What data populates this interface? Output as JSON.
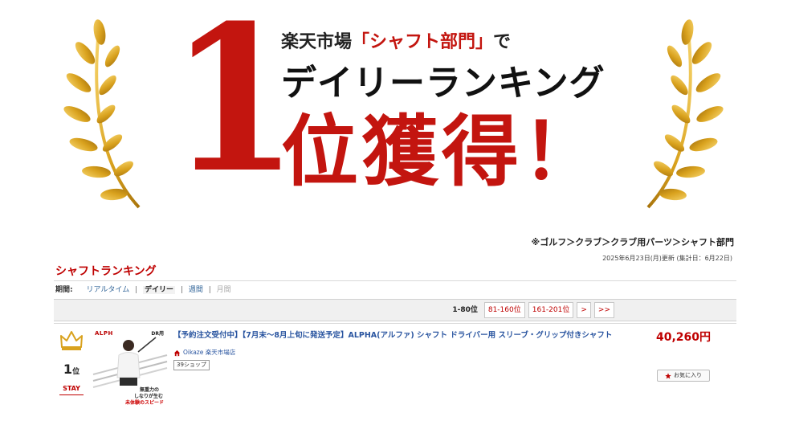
{
  "banner": {
    "line1_pre": "楽天市場",
    "line1_bracket": "「シャフト部門」",
    "line1_post": "で",
    "line2": "デイリーランキング",
    "big_number": "1",
    "line3": "位獲得！"
  },
  "breadcrumb": "※ゴルフ＞クラブ＞クラブ用パーツ＞シャフト部門",
  "updated": "2025年6月23日(月)更新 (集計日：6月22日)",
  "ranking_title": "シャフトランキング",
  "period": {
    "label": "期間:",
    "options": [
      "リアルタイム",
      "デイリー",
      "週間",
      "月間"
    ],
    "active": "デイリー"
  },
  "pager": {
    "current": "1-80位",
    "pages": [
      "81-160位",
      "161-201位",
      ">",
      ">>"
    ]
  },
  "item": {
    "rank": "1",
    "rank_suffix": "位",
    "status": "STAY",
    "thumb": {
      "logo": "ALPH",
      "dr": "DR用",
      "text1": "無重力の",
      "text2": "しなりが生む",
      "text3": "未体験のスピード"
    },
    "title": "【予約注文受付中】【7月末～8月上旬に発送予定】ALPHA(アルファ) シャフト ドライバー用 スリーブ・グリップ付きシャフト",
    "shop_name": "Oikaze 楽天市場店",
    "shop_badge": "39ショップ",
    "price": "40,260円",
    "favorite_label": "お気に入り"
  },
  "colors": {
    "accent_red": "#bf0000",
    "banner_red": "#c3150f",
    "gold": "#d9a21e",
    "link_blue": "#2a55a0"
  }
}
